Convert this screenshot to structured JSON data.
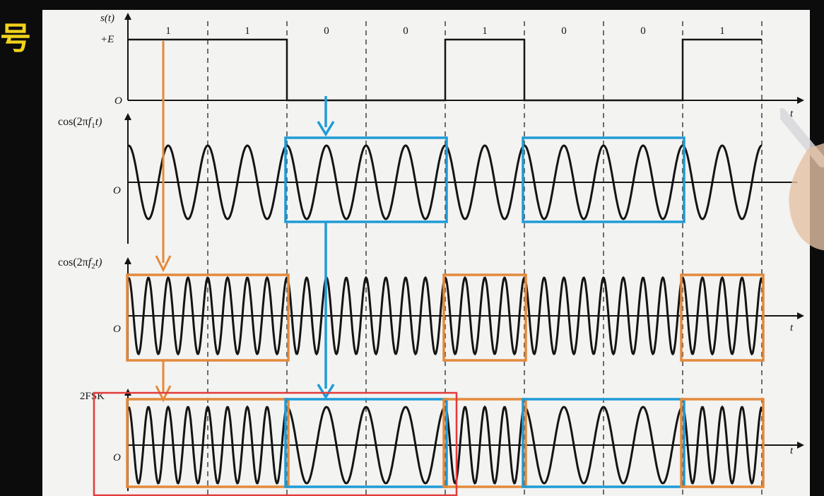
{
  "side_char": "号",
  "bits": [
    "1",
    "1",
    "0",
    "0",
    "1",
    "0",
    "0",
    "1"
  ],
  "labels": {
    "s_axis": "s(t)",
    "plus_e": "+E",
    "origin": "O",
    "t_axis": "t",
    "cos1_pre": "cos(2π",
    "cos2_pre": "cos(2π",
    "f": "f",
    "sub1": "1",
    "sub2": "2",
    "t_close": "t)",
    "fsk": "2FSK"
  },
  "signal": {
    "cycles_per_bit_f1": 2,
    "cycles_per_bit_f2": 4
  },
  "colors": {
    "ink": "#141414",
    "grid": "#333333",
    "sheet": "#f3f3f1",
    "orange": "#e38a3c",
    "blue": "#1f9bd7",
    "red": "#e23b3b",
    "side_char": "#f2d21c"
  }
}
